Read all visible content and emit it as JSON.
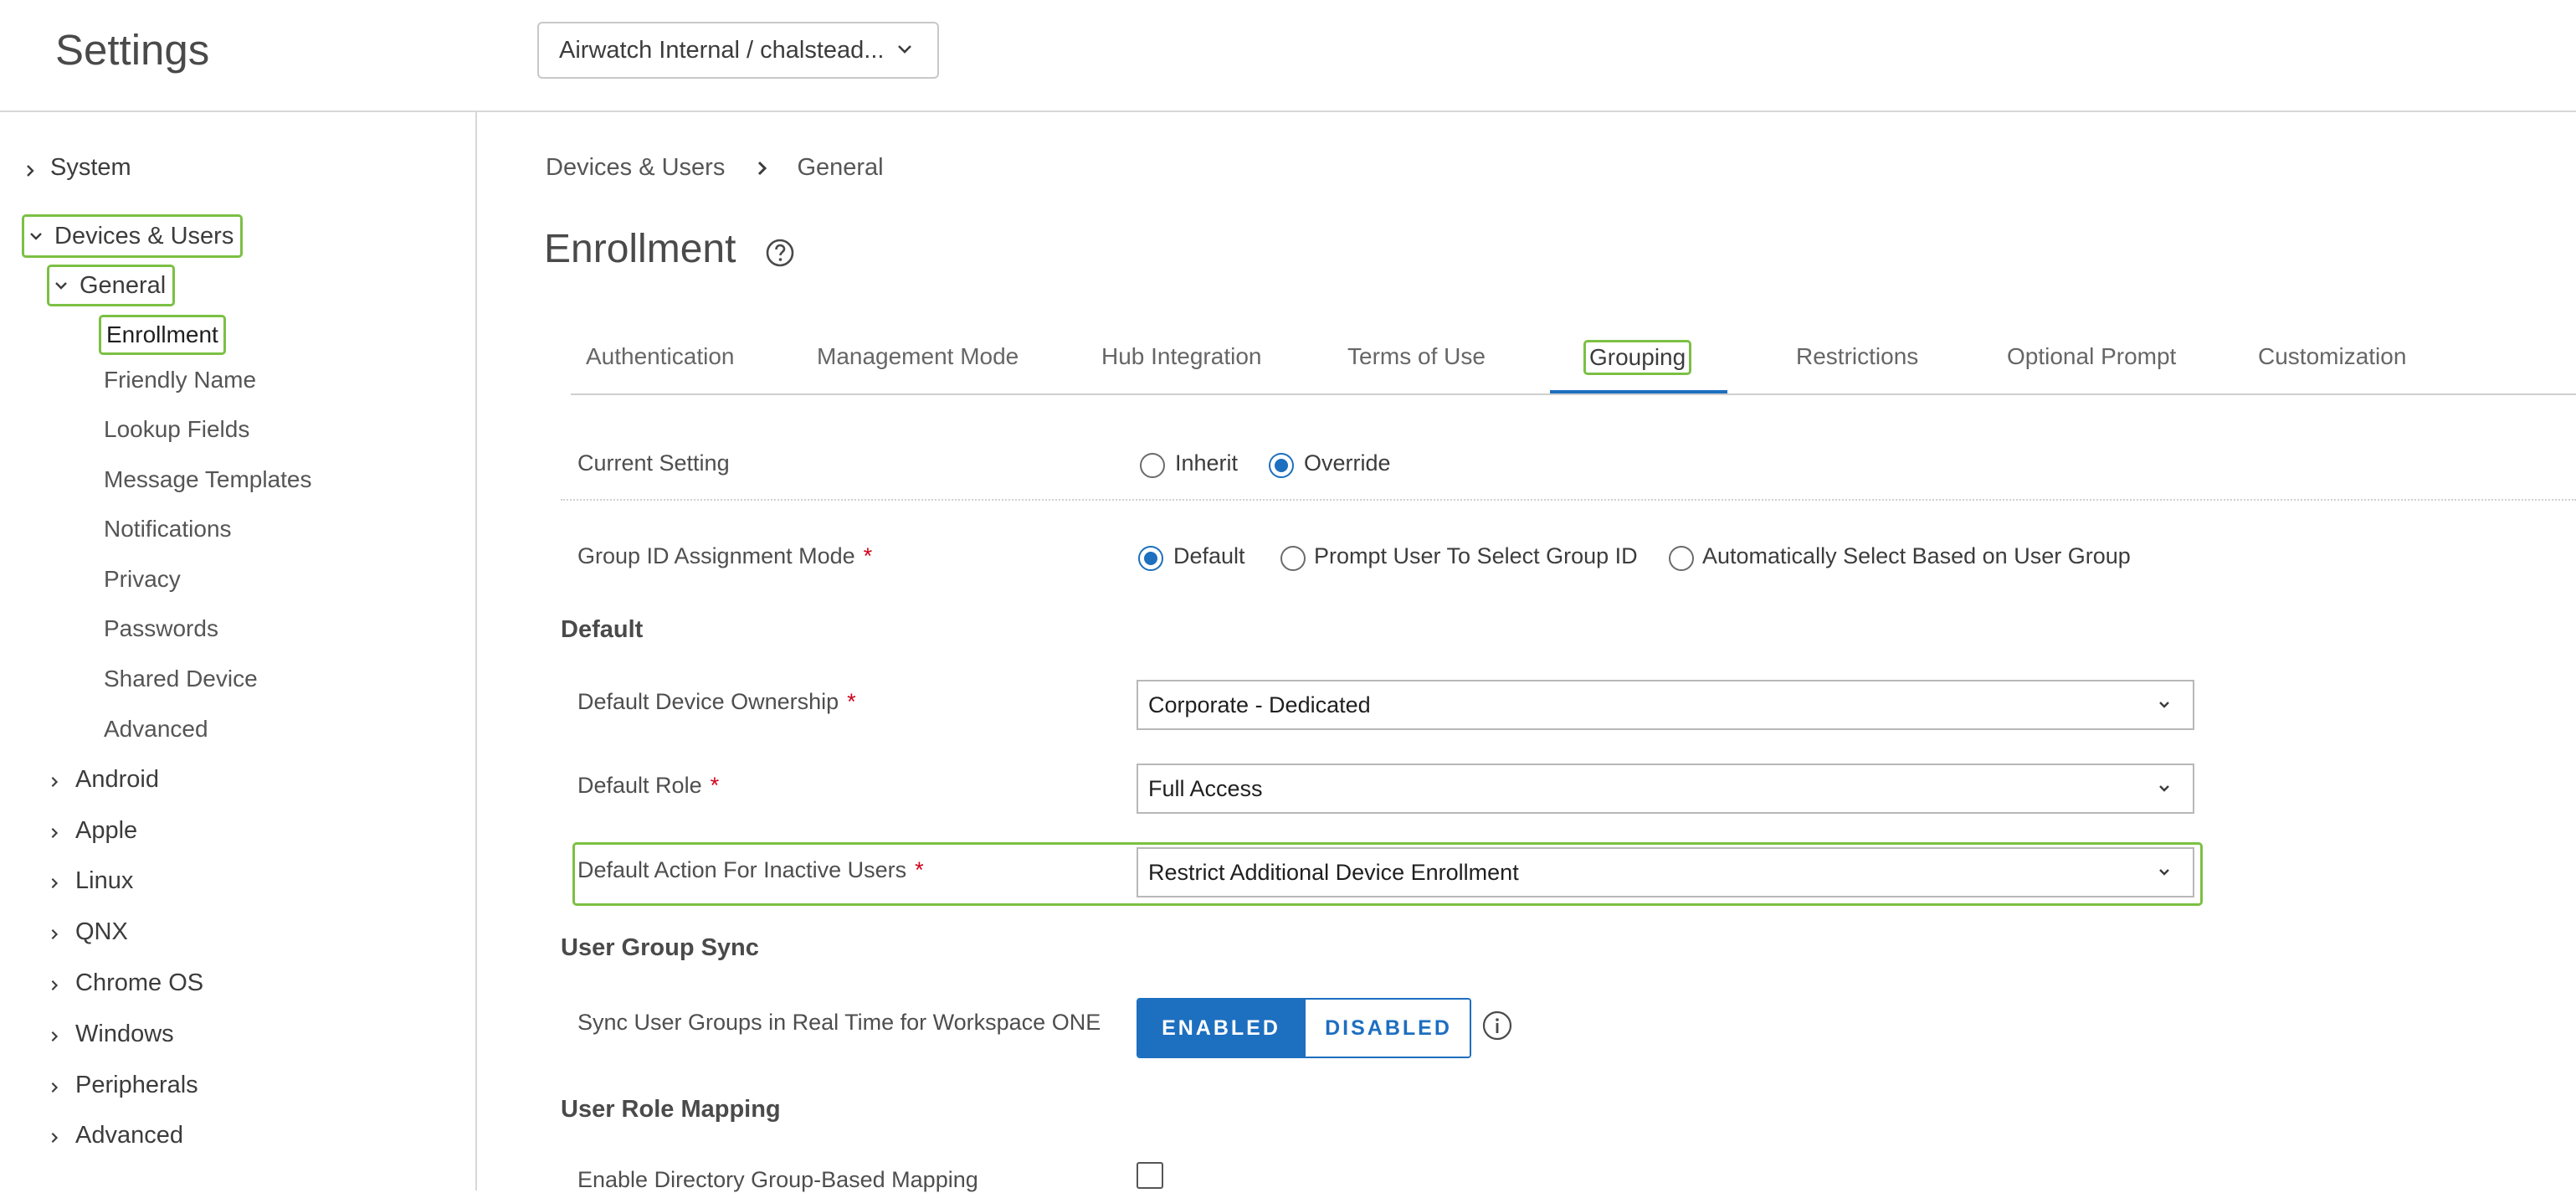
{
  "header": {
    "title": "Settings",
    "org_selector": "Airwatch Internal / chalstead..."
  },
  "sidebar": {
    "system": "System",
    "devices_users": "Devices & Users",
    "general": "General",
    "general_items": [
      "Enrollment",
      "Friendly Name",
      "Lookup Fields",
      "Message Templates",
      "Notifications",
      "Privacy",
      "Passwords",
      "Shared Device",
      "Advanced"
    ],
    "platforms": [
      "Android",
      "Apple",
      "Linux",
      "QNX",
      "Chrome OS",
      "Windows",
      "Peripherals",
      "Advanced"
    ]
  },
  "breadcrumb": {
    "parent": "Devices & Users",
    "current": "General"
  },
  "page": {
    "title": "Enrollment"
  },
  "tabs": [
    "Authentication",
    "Management Mode",
    "Hub Integration",
    "Terms of Use",
    "Grouping",
    "Restrictions",
    "Optional Prompt",
    "Customization"
  ],
  "active_tab": "Grouping",
  "form": {
    "current_setting": {
      "label": "Current Setting",
      "options": [
        "Inherit",
        "Override"
      ],
      "selected": "Override"
    },
    "group_id_mode": {
      "label": "Group ID Assignment Mode",
      "options": [
        "Default",
        "Prompt User To Select Group ID",
        "Automatically Select Based on User Group"
      ],
      "selected": "Default"
    },
    "default_section": "Default",
    "device_ownership": {
      "label": "Default Device Ownership",
      "value": "Corporate - Dedicated"
    },
    "default_role": {
      "label": "Default Role",
      "value": "Full Access"
    },
    "inactive_action": {
      "label": "Default Action For Inactive Users",
      "value": "Restrict Additional Device Enrollment"
    },
    "user_group_sync_section": "User Group Sync",
    "sync_realtime": {
      "label": "Sync User Groups in Real Time for Workspace ONE",
      "enabled": "ENABLED",
      "disabled": "DISABLED",
      "selected": "ENABLED"
    },
    "user_role_mapping_section": "User Role Mapping",
    "directory_mapping": {
      "label": "Enable Directory Group-Based Mapping",
      "checked": false
    }
  },
  "colors": {
    "accent": "#1d6fbf",
    "highlight": "#7bc043",
    "required": "#d0021b"
  },
  "icons": {
    "help": "help-circle-icon",
    "info": "info-icon",
    "expand": "chevron-right-icon",
    "collapse": "chevron-down-icon"
  }
}
